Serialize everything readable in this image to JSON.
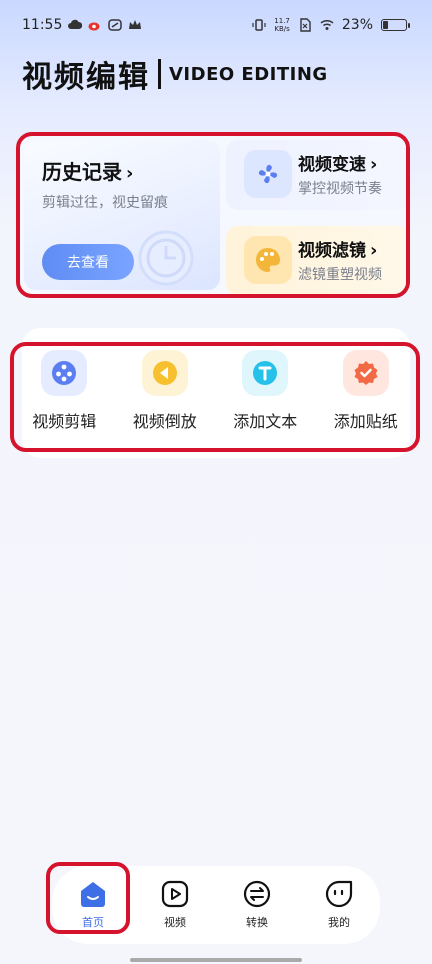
{
  "status_bar": {
    "time": "11:55",
    "network_speed_value": "11.7",
    "network_speed_unit": "KB/s",
    "battery_percent": "23%",
    "battery_level": 0.23
  },
  "header": {
    "title_cn": "视频编辑",
    "title_en": "VIDEO EDITING"
  },
  "cards": {
    "history": {
      "title": "历史记录",
      "subtitle": "剪辑过往，视史留痕",
      "button": "去查看"
    },
    "speed": {
      "title": "视频变速",
      "subtitle": "掌控视频节奏"
    },
    "filter": {
      "title": "视频滤镜",
      "subtitle": "滤镜重塑视频"
    }
  },
  "tools": [
    {
      "label": "视频剪辑",
      "icon": "film-reel-icon",
      "color": "#5b7ff0"
    },
    {
      "label": "视频倒放",
      "icon": "rewind-icon",
      "color": "#f6c02f"
    },
    {
      "label": "添加文本",
      "icon": "text-icon",
      "color": "#26c1e8"
    },
    {
      "label": "添加贴纸",
      "icon": "sticker-icon",
      "color": "#f26a45"
    }
  ],
  "nav": [
    {
      "label": "首页",
      "icon": "home-icon",
      "active": true
    },
    {
      "label": "视频",
      "icon": "video-icon",
      "active": false
    },
    {
      "label": "转换",
      "icon": "convert-icon",
      "active": false
    },
    {
      "label": "我的",
      "icon": "profile-icon",
      "active": false
    }
  ],
  "colors": {
    "accent": "#3f6fe6",
    "highlight_border": "#d6132c"
  }
}
